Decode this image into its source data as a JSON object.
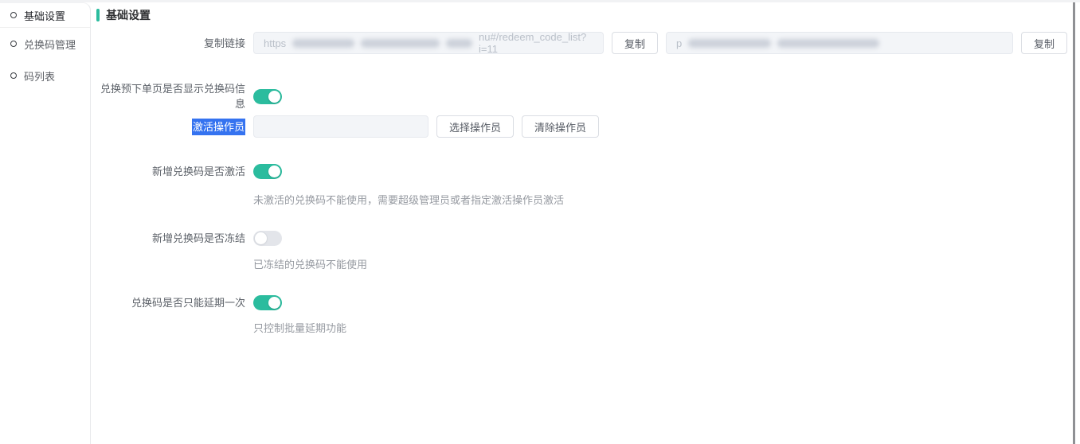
{
  "sidebar": {
    "items": [
      {
        "label": "基础设置",
        "active": true
      },
      {
        "label": "兑换码管理",
        "active": false
      },
      {
        "label": "码列表",
        "active": false
      }
    ]
  },
  "header": {
    "title": "基础设置"
  },
  "form": {
    "copy_link": {
      "label": "复制链接",
      "url_prefix": "https",
      "url_suffix": "nu#/redeem_code_list?i=11",
      "copy_button": "复制",
      "secret_prefix": "p",
      "copy_button2": "复制"
    },
    "show_info": {
      "label": "兑换预下单页是否显示兑换码信息",
      "on": true
    },
    "operator": {
      "label": "激活操作员",
      "value": "",
      "select_button": "选择操作员",
      "clear_button": "清除操作员"
    },
    "activate": {
      "label": "新增兑换码是否激活",
      "on": true,
      "hint": "未激活的兑换码不能使用，需要超级管理员或者指定激活操作员激活"
    },
    "freeze": {
      "label": "新增兑换码是否冻结",
      "on": false,
      "hint": "已冻结的兑换码不能使用"
    },
    "delay_once": {
      "label": "兑换码是否只能延期一次",
      "on": true,
      "hint": "只控制批量延期功能"
    }
  },
  "colors": {
    "accent": "#2bbc9e",
    "selection": "#3573f0"
  }
}
